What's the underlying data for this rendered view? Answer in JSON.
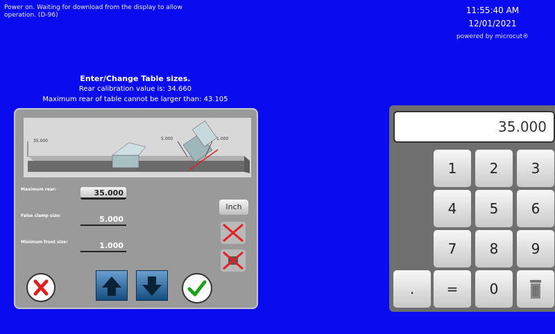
{
  "status": {
    "message": "Power on. Waiting for download from the display to allow operation. (D-96)"
  },
  "clock": {
    "time": "11:55:40 AM",
    "date": "12/01/2021",
    "brand": "powered by microcut®"
  },
  "info": {
    "title": "Enter/Change Table sizes.",
    "calibration": "Rear calibration value is:  34.660",
    "max_rear": "Maximum rear of table cannot be larger than:  43.105"
  },
  "diagram": {
    "label_rear": "35.000",
    "label_clamp": "5.000",
    "label_front": "1.000"
  },
  "fields": [
    {
      "label": "Maximum rear:",
      "value": "35.000"
    },
    {
      "label": "False clamp size:",
      "value": "5.000"
    },
    {
      "label": "Minimum front size:",
      "value": "1.000"
    }
  ],
  "units_button": "Inch",
  "keypad": {
    "display": "35.000",
    "keys": {
      "k1": "1",
      "k2": "2",
      "k3": "3",
      "k4": "4",
      "k5": "5",
      "k6": "6",
      "k7": "7",
      "k8": "8",
      "k9": "9",
      "dot": ".",
      "equals": "=",
      "k0": "0"
    }
  },
  "colors": {
    "background": "#0b0bf0",
    "panel": "#9a9a9a",
    "cancel_red": "#e02020",
    "ok_green": "#1aa31a"
  }
}
